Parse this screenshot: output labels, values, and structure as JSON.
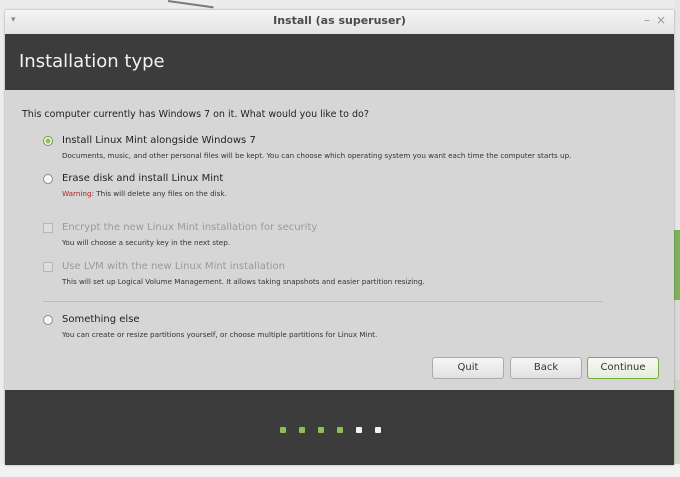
{
  "window": {
    "title": "Install (as superuser)",
    "menu_glyph": "▾",
    "minimize_glyph": "–",
    "close_glyph": "×"
  },
  "header": {
    "title": "Installation type"
  },
  "question": "This computer currently has Windows 7 on it. What would you like to do?",
  "options": [
    {
      "label": "Install Linux Mint alongside Windows 7",
      "description": "Documents, music, and other personal files will be kept. You can choose which operating system you want each time the computer starts up.",
      "selected": true
    },
    {
      "label": "Erase disk and install Linux Mint",
      "warning_prefix": "Warning",
      "description": ": This will delete any files on the disk.",
      "selected": false
    },
    {
      "label": "Encrypt the new Linux Mint installation for security",
      "description": "You will choose a security key in the next step.",
      "checked": false,
      "enabled": false
    },
    {
      "label": "Use LVM with the new Linux Mint installation",
      "description": "This will set up Logical Volume Management. It allows taking snapshots and easier partition resizing.",
      "checked": false,
      "enabled": false
    },
    {
      "label": "Something else",
      "description": "You can create or resize partitions yourself, or choose multiple partitions for Linux Mint.",
      "selected": false
    }
  ],
  "buttons": {
    "quit": "Quit",
    "back": "Back",
    "continue": "Continue"
  },
  "progress": {
    "completed_steps": 4,
    "total_steps": 6
  },
  "colors": {
    "accent": "#8fbf52",
    "header_bg": "#3c3c3c",
    "warning": "#b02020"
  }
}
